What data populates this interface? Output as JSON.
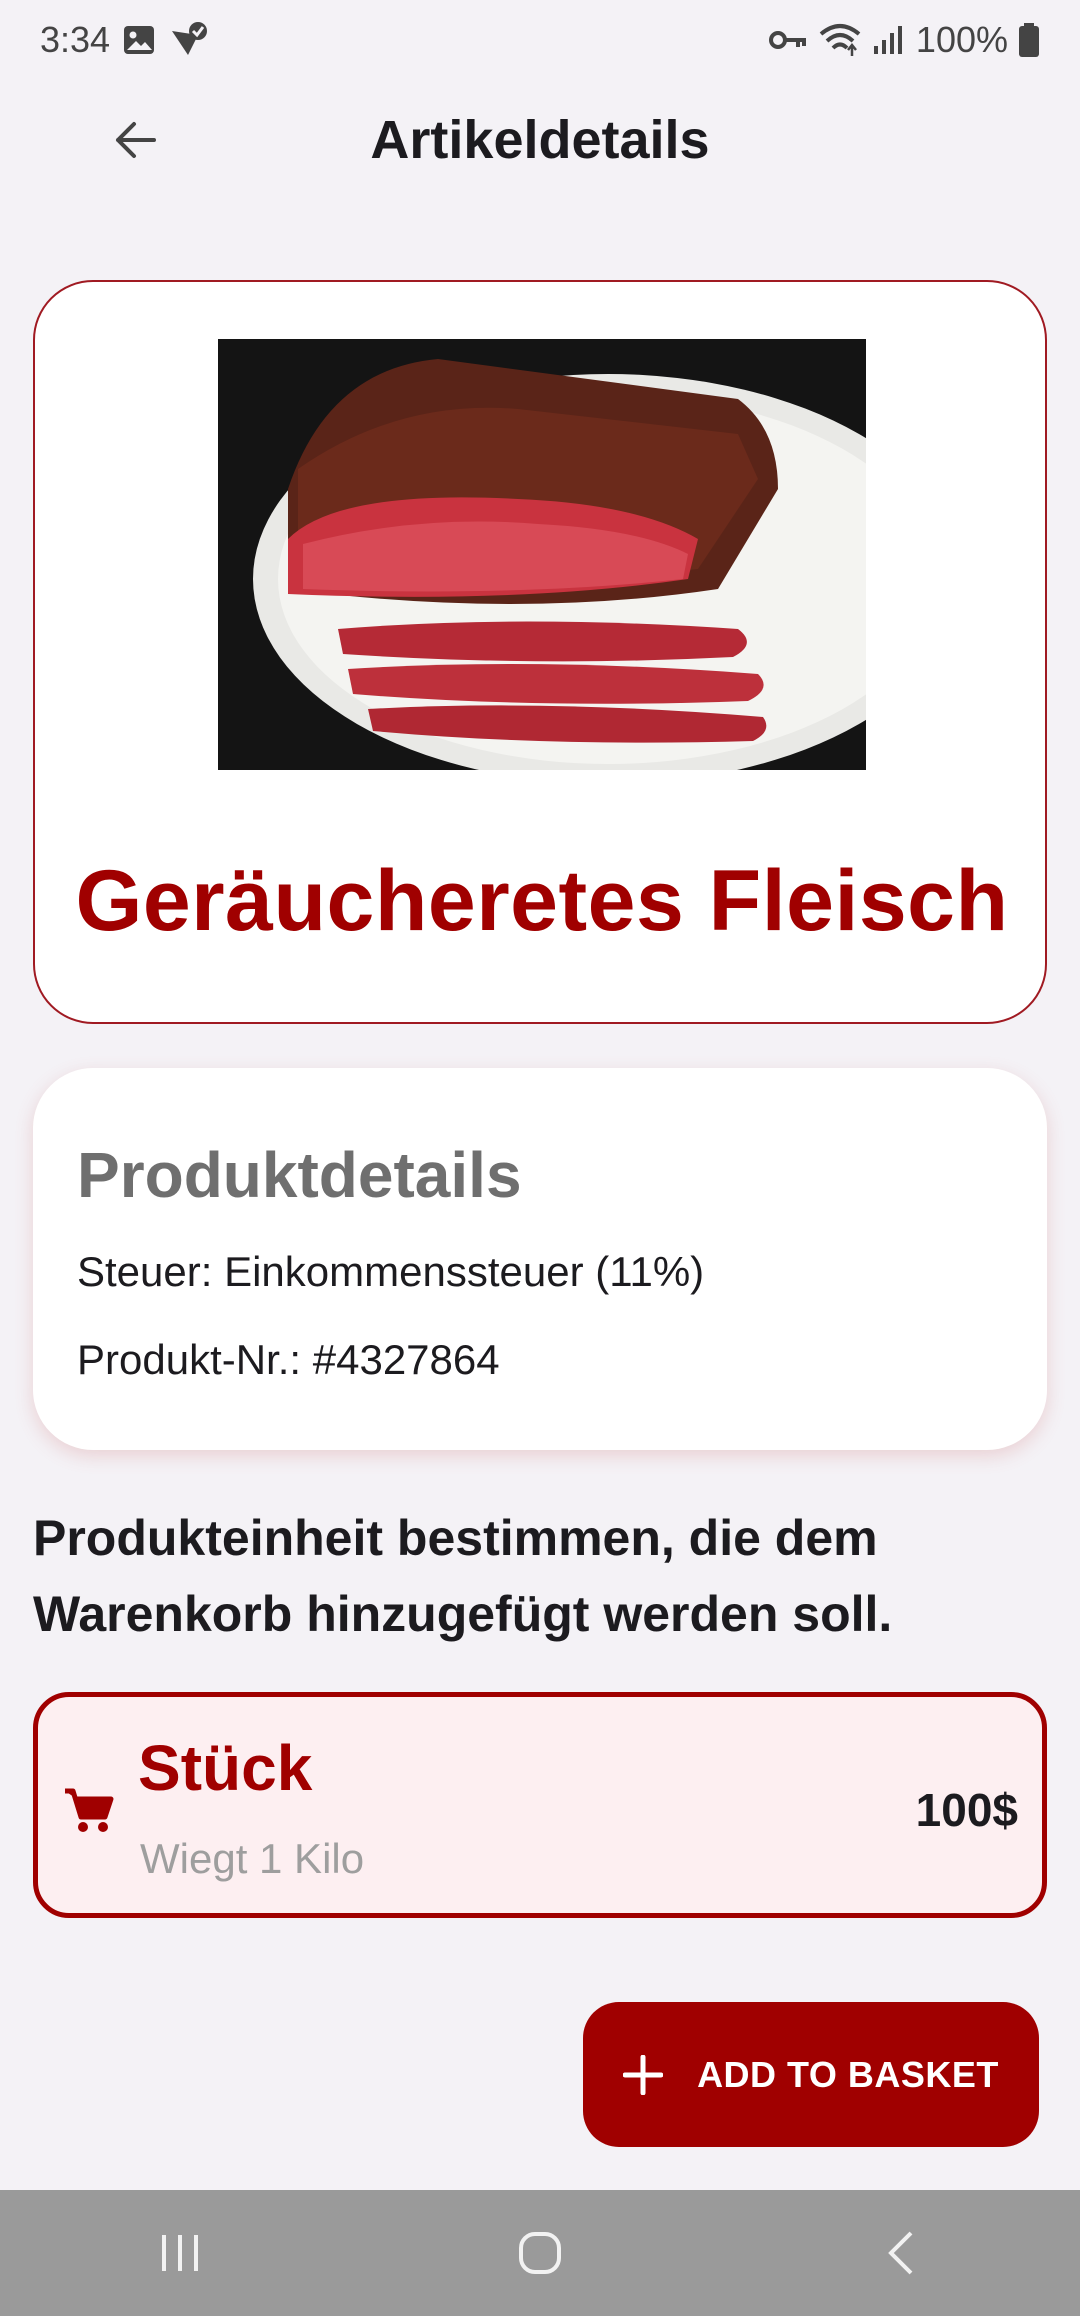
{
  "status_bar": {
    "time": "3:34",
    "battery": "100%"
  },
  "app_bar": {
    "title": "Artikeldetails"
  },
  "product": {
    "name": "Geräucheretes Fleisch"
  },
  "details": {
    "title": "Produktdetails",
    "tax_line": "Steuer: Einkommenssteuer (11%)",
    "number_line": "Produkt-Nr.: #4327864"
  },
  "instruction": {
    "text": "Produkteinheit bestimmen, die dem Warenkorb hinzugefügt werden soll."
  },
  "unit_option": {
    "name": "Stück",
    "description": "Wiegt 1 Kilo",
    "price": "100$"
  },
  "add_button": {
    "label": "ADD TO BASKET"
  },
  "colors": {
    "accent": "#a00000",
    "background": "#f4f2f6",
    "option_bg": "#fdeff1"
  }
}
